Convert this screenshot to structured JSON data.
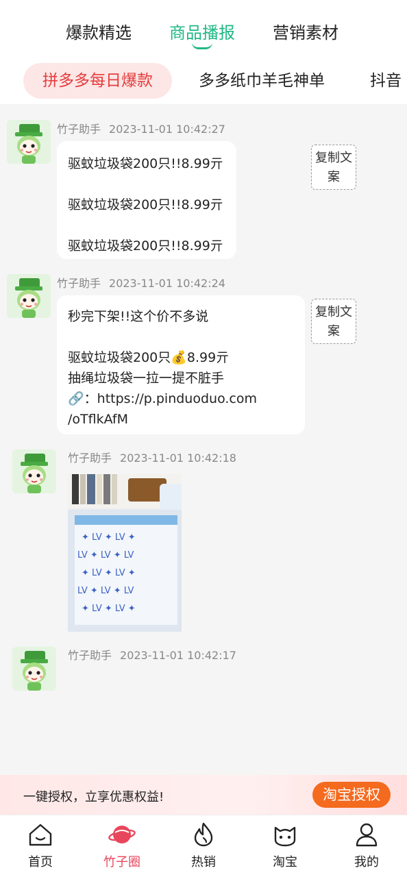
{
  "top_tabs": [
    {
      "label": "爆款精选",
      "active": false
    },
    {
      "label": "商品播报",
      "active": true
    },
    {
      "label": "营销素材",
      "active": false
    }
  ],
  "chips": [
    {
      "label": "拼多多每日爆款",
      "active": true
    },
    {
      "label": "多多纸巾羊毛神单",
      "active": false
    },
    {
      "label": "抖音",
      "active": false
    }
  ],
  "messages": [
    {
      "sender": "竹子助手",
      "time": "2023-11-01 10:42:27",
      "lines": [
        "驱蚊垃圾袋200只!!8.99亓",
        "",
        "驱蚊垃圾袋200只!!8.99亓",
        "",
        "驱蚊垃圾袋200只!!8.99亓"
      ],
      "copy_label": "复制文案"
    },
    {
      "sender": "竹子助手",
      "time": "2023-11-01 10:42:24",
      "lines": [
        "秒完下架!!这个价不多说",
        "",
        "驱蚊垃圾袋200只💰8.99亓",
        "抽绳垃圾袋一拉一提不脏手",
        "🔗：https://p.pinduoduo.com",
        "/oTflkAfM"
      ],
      "copy_label": "复制文案"
    },
    {
      "sender": "竹子助手",
      "time": "2023-11-01 10:42:18"
    },
    {
      "sender": "竹子助手",
      "time": "2023-11-01 10:42:17"
    }
  ],
  "auth_banner": {
    "text": "一键授权，立享优惠权益!",
    "button": "淘宝授权"
  },
  "bottom_nav": [
    {
      "label": "首页",
      "icon": "home-icon",
      "active": false
    },
    {
      "label": "竹子圈",
      "icon": "planet-icon",
      "active": true
    },
    {
      "label": "热销",
      "icon": "flame-icon",
      "active": false
    },
    {
      "label": "淘宝",
      "icon": "taobao-icon",
      "active": false
    },
    {
      "label": "我的",
      "icon": "user-icon",
      "active": false
    }
  ],
  "colors": {
    "accent_green": "#1fb883",
    "accent_red": "#e43c3c",
    "auth_orange": "#f46a1e"
  }
}
